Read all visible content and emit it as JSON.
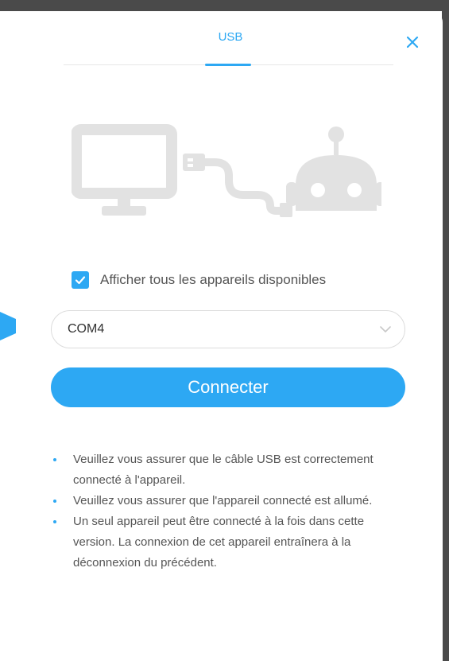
{
  "dialog": {
    "tab_label": "USB",
    "close_icon": "close-icon",
    "accent_color": "#2da8f3"
  },
  "illustration": {
    "icons": [
      "monitor-icon",
      "usb-cable-icon",
      "robot-icon"
    ]
  },
  "show_all_devices": {
    "label": "Afficher tous les appareils disponibles",
    "checked": true
  },
  "port_select": {
    "value": "COM4"
  },
  "connect_button": {
    "label": "Connecter"
  },
  "tips": [
    "Veuillez vous assurer que le câble USB est correctement connecté à l'appareil.",
    "Veuillez vous assurer que l'appareil connecté est allumé.",
    "Un seul appareil peut être connecté à la fois dans cette version. La connexion de cet appareil entraînera à la déconnexion du précédent."
  ]
}
